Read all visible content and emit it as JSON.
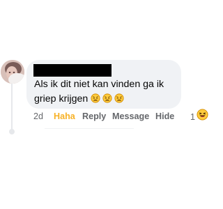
{
  "comment": {
    "author": {
      "name": "",
      "redacted": true
    },
    "text": "Als ik dit niet kan vinden ga ik griep krijgen",
    "emojis": [
      "weary-face-emoji",
      "weary-face-emoji",
      "weary-face-emoji"
    ],
    "timestamp": "2d",
    "actions": {
      "haha": "Haha",
      "reply": "Reply",
      "message": "Message",
      "hide": "Hide"
    },
    "reaction": {
      "count": "1",
      "icon": "haha-reaction-icon"
    }
  },
  "colors": {
    "bubble": "#f0f2f5",
    "text": "#050505",
    "secondary_text": "#65676b",
    "haha_active": "#f7b125",
    "emoji_yellow": "#ffcc3d",
    "emoji_outline": "#d28b00"
  }
}
